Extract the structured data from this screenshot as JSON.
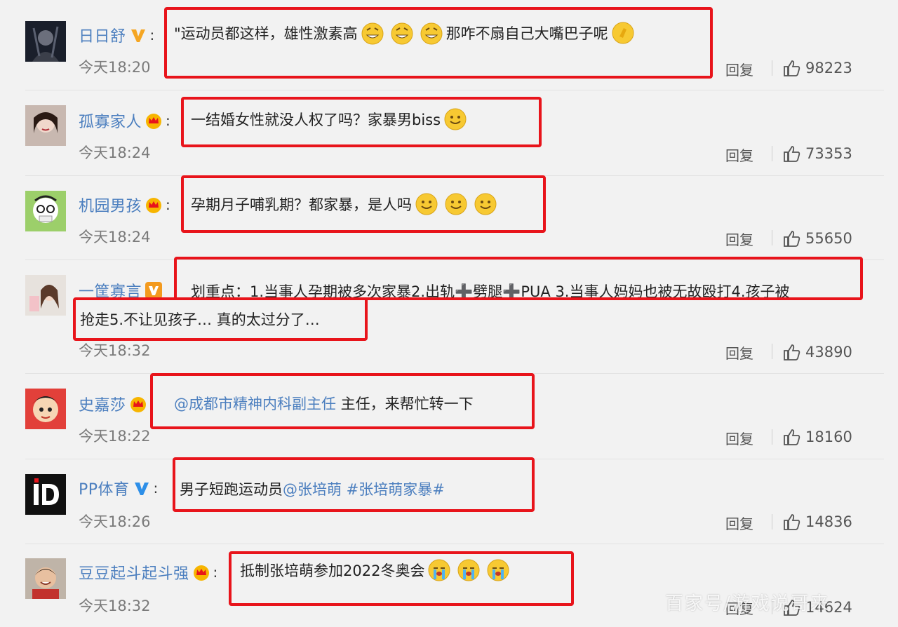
{
  "comments": [
    {
      "username": "日日舒",
      "badge": "verified-v-gold",
      "text": "\"运动员都这样，雄性激素高",
      "emojis": [
        "grin-emoji",
        "grin-emoji",
        "grin-emoji"
      ],
      "text2": "那咋不扇自己大嘴巴子呢",
      "emoji2": "clap-emoji",
      "time": "今天18:20",
      "reply": "回复",
      "likes": "98223"
    },
    {
      "username": "孤寡家人",
      "badge": "vip-crown",
      "text": "一结婚女性就没人权了吗？家暴男biss",
      "emojis": [
        "smile-emoji"
      ],
      "time": "今天18:24",
      "reply": "回复",
      "likes": "73353"
    },
    {
      "username": "机园男孩",
      "badge": "vip-crown",
      "text": "孕期月子哺乳期？都家暴，是人吗",
      "emojis": [
        "smile-emoji",
        "smile-emoji",
        "smile-emoji"
      ],
      "time": "今天18:24",
      "reply": "回复",
      "likes": "55650"
    },
    {
      "username": "一筐寡言",
      "badge": "verified-v-orange",
      "text": "划重点：1.当事人孕期被多次家暴2.出轨➕劈腿➕PUA 3.当事人妈妈也被无故殴打4.孩子被",
      "text2": "抢走5.不让见孩子… 真的太过分了…",
      "time": "今天18:32",
      "reply": "回复",
      "likes": "43890"
    },
    {
      "username": "史嘉莎",
      "badge": "vip-crown",
      "mention": "@成都市精神内科副主任",
      "text": " 主任，来帮忙转一下",
      "time": "今天18:22",
      "reply": "回复",
      "likes": "18160"
    },
    {
      "username": "PP体育",
      "badge": "verified-v-blue",
      "text": "男子短跑运动员",
      "mention": "@张培萌 #张培萌家暴#",
      "time": "今天18:26",
      "reply": "回复",
      "likes": "14836"
    },
    {
      "username": "豆豆起斗起斗强",
      "badge": "vip-crown",
      "text": "抵制张培萌参加2022冬奥会",
      "emojis": [
        "cry-emoji",
        "cry-emoji",
        "cry-emoji"
      ],
      "time": "今天18:32",
      "reply": "回复",
      "likes": "14624"
    }
  ],
  "colors": {
    "highlight": "#e8141b",
    "username": "#4c7fbf",
    "background": "#f2f2f2"
  },
  "watermark": "百家号/游戏说哥来"
}
